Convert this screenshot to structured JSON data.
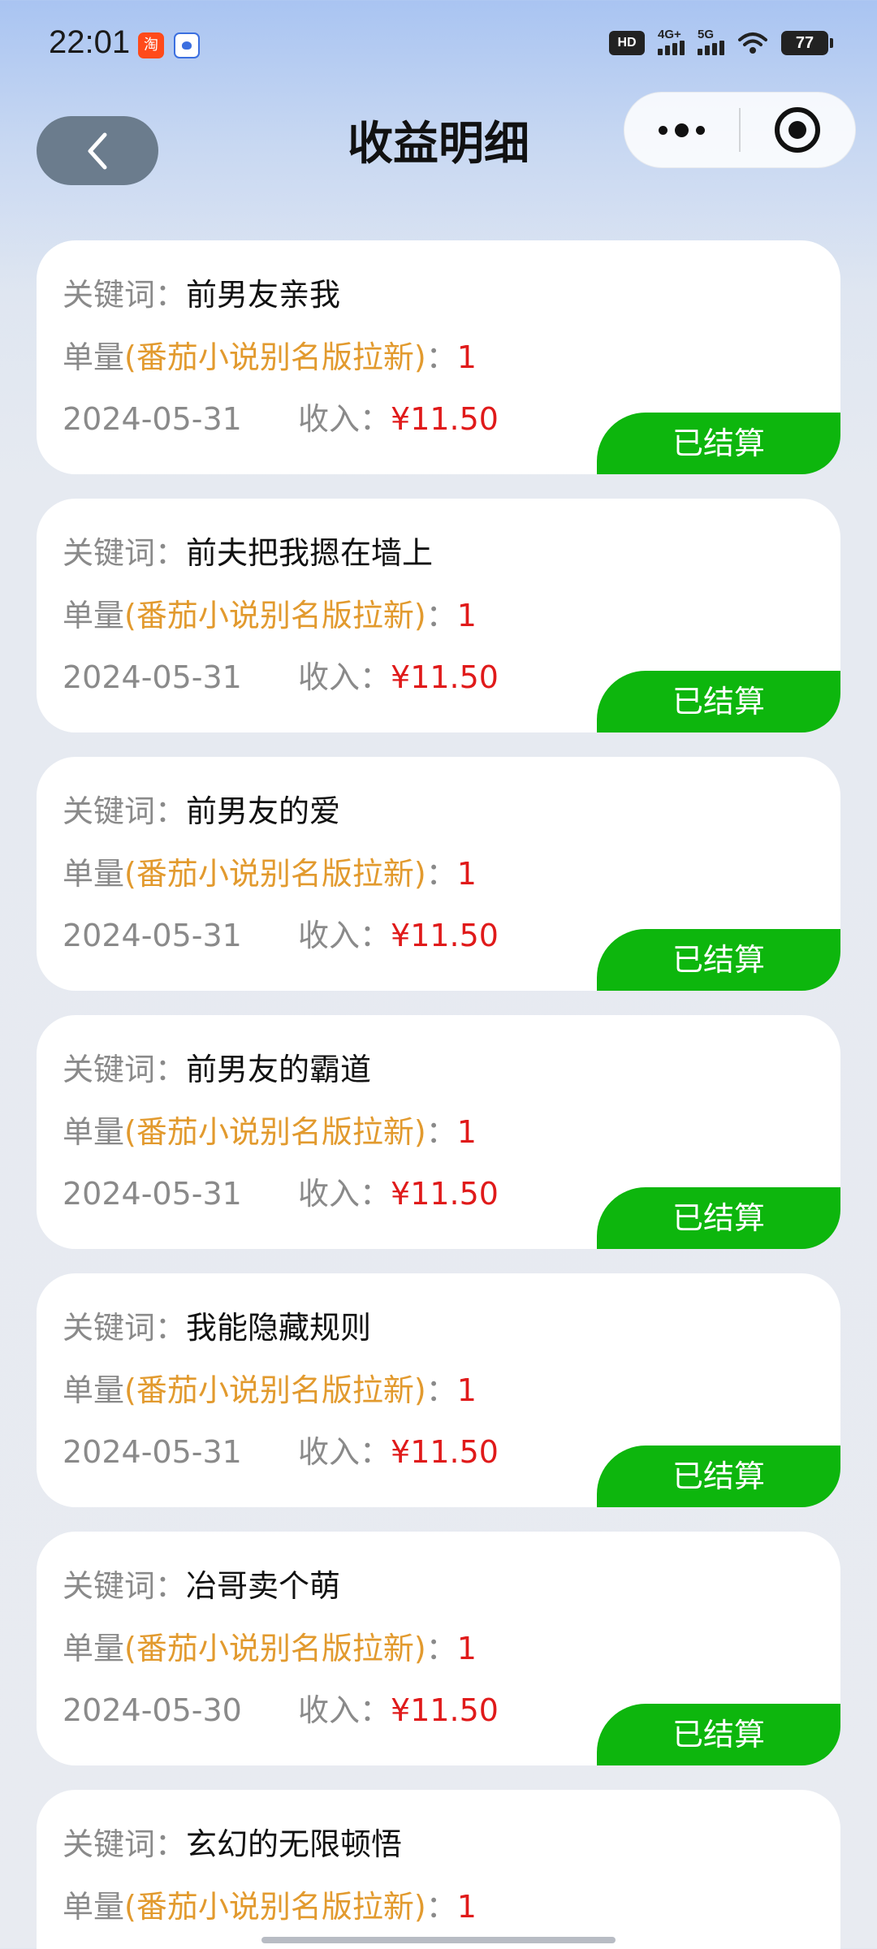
{
  "status_bar": {
    "time": "22:01",
    "network_label": "4G+",
    "network_label_2": "5G",
    "hd_label": "HD",
    "battery": "77"
  },
  "header": {
    "title": "收益明细"
  },
  "labels": {
    "keyword": "关键词：",
    "count_prefix": "单量",
    "count_product": "(番茄小说别名版拉新)",
    "count_colon": "：",
    "income": "收入：",
    "settled": "已结算"
  },
  "records": [
    {
      "keyword": "前男友亲我",
      "count": "1",
      "date": "2024-05-31",
      "amount": "¥11.50",
      "status": "已结算"
    },
    {
      "keyword": "前夫把我摁在墙上",
      "count": "1",
      "date": "2024-05-31",
      "amount": "¥11.50",
      "status": "已结算"
    },
    {
      "keyword": "前男友的爱",
      "count": "1",
      "date": "2024-05-31",
      "amount": "¥11.50",
      "status": "已结算"
    },
    {
      "keyword": "前男友的霸道",
      "count": "1",
      "date": "2024-05-31",
      "amount": "¥11.50",
      "status": "已结算"
    },
    {
      "keyword": "我能隐藏规则",
      "count": "1",
      "date": "2024-05-31",
      "amount": "¥11.50",
      "status": "已结算"
    },
    {
      "keyword": "冶哥卖个萌",
      "count": "1",
      "date": "2024-05-30",
      "amount": "¥11.50",
      "status": "已结算"
    },
    {
      "keyword": "玄幻的无限顿悟",
      "count": "1"
    }
  ],
  "colors": {
    "settled_green": "#0db60d",
    "amount_red": "#e01a1a",
    "product_orange": "#e29a2e"
  }
}
